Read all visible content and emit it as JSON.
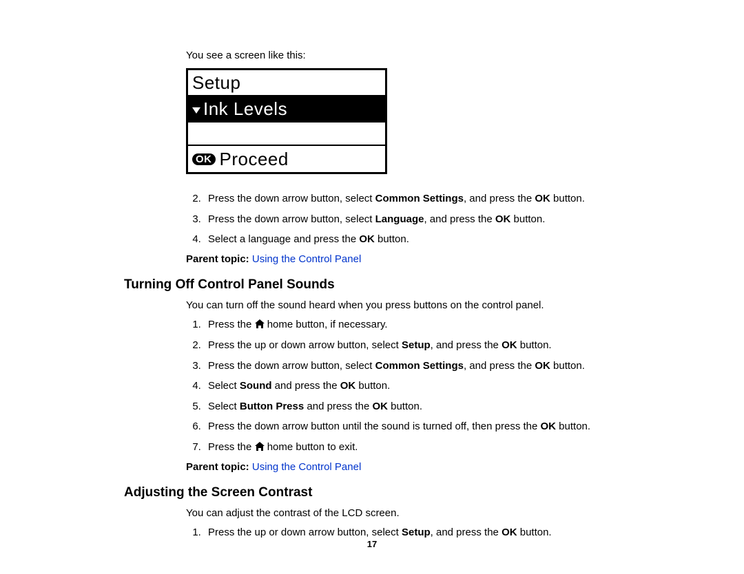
{
  "intro": "You see a screen like this:",
  "lcd": {
    "title": "Setup",
    "selected": "Ink Levels",
    "ok_badge": "OK",
    "proceed": "Proceed"
  },
  "steps_top": {
    "start": 2,
    "items": [
      {
        "pre": "Press the down arrow button, select ",
        "b1": "Common Settings",
        "mid": ", and press the ",
        "b2": "OK",
        "post": " button."
      },
      {
        "pre": "Press the down arrow button, select ",
        "b1": "Language",
        "mid": ", and press the ",
        "b2": "OK",
        "post": " button."
      },
      {
        "pre": "Select a language and press the ",
        "b1": "OK",
        "mid": " button.",
        "b2": "",
        "post": ""
      }
    ]
  },
  "parent_topic": {
    "label": "Parent topic: ",
    "link": "Using the Control Panel"
  },
  "section1": {
    "heading": "Turning Off Control Panel Sounds",
    "intro": "You can turn off the sound heard when you press buttons on the control panel.",
    "steps": [
      {
        "pre": "Press the ",
        "icon": true,
        "mid": " home button, if necessary."
      },
      {
        "pre": "Press the up or down arrow button, select ",
        "b1": "Setup",
        "mid": ", and press the ",
        "b2": "OK",
        "post": " button."
      },
      {
        "pre": "Press the down arrow button, select ",
        "b1": "Common Settings",
        "mid": ", and press the ",
        "b2": "OK",
        "post": " button."
      },
      {
        "pre": "Select ",
        "b1": "Sound",
        "mid": " and press the ",
        "b2": "OK",
        "post": " button."
      },
      {
        "pre": "Select ",
        "b1": "Button Press",
        "mid": " and press the ",
        "b2": "OK",
        "post": " button."
      },
      {
        "pre": "Press the down arrow button until the sound is turned off, then press the ",
        "b1": "OK",
        "mid": " button.",
        "b2": "",
        "post": ""
      },
      {
        "pre": "Press the ",
        "icon": true,
        "mid": " home button to exit."
      }
    ]
  },
  "section2": {
    "heading": "Adjusting the Screen Contrast",
    "intro": "You can adjust the contrast of the LCD screen.",
    "steps": [
      {
        "pre": "Press the up or down arrow button, select ",
        "b1": "Setup",
        "mid": ", and press the ",
        "b2": "OK",
        "post": " button."
      }
    ]
  },
  "page_number": "17"
}
